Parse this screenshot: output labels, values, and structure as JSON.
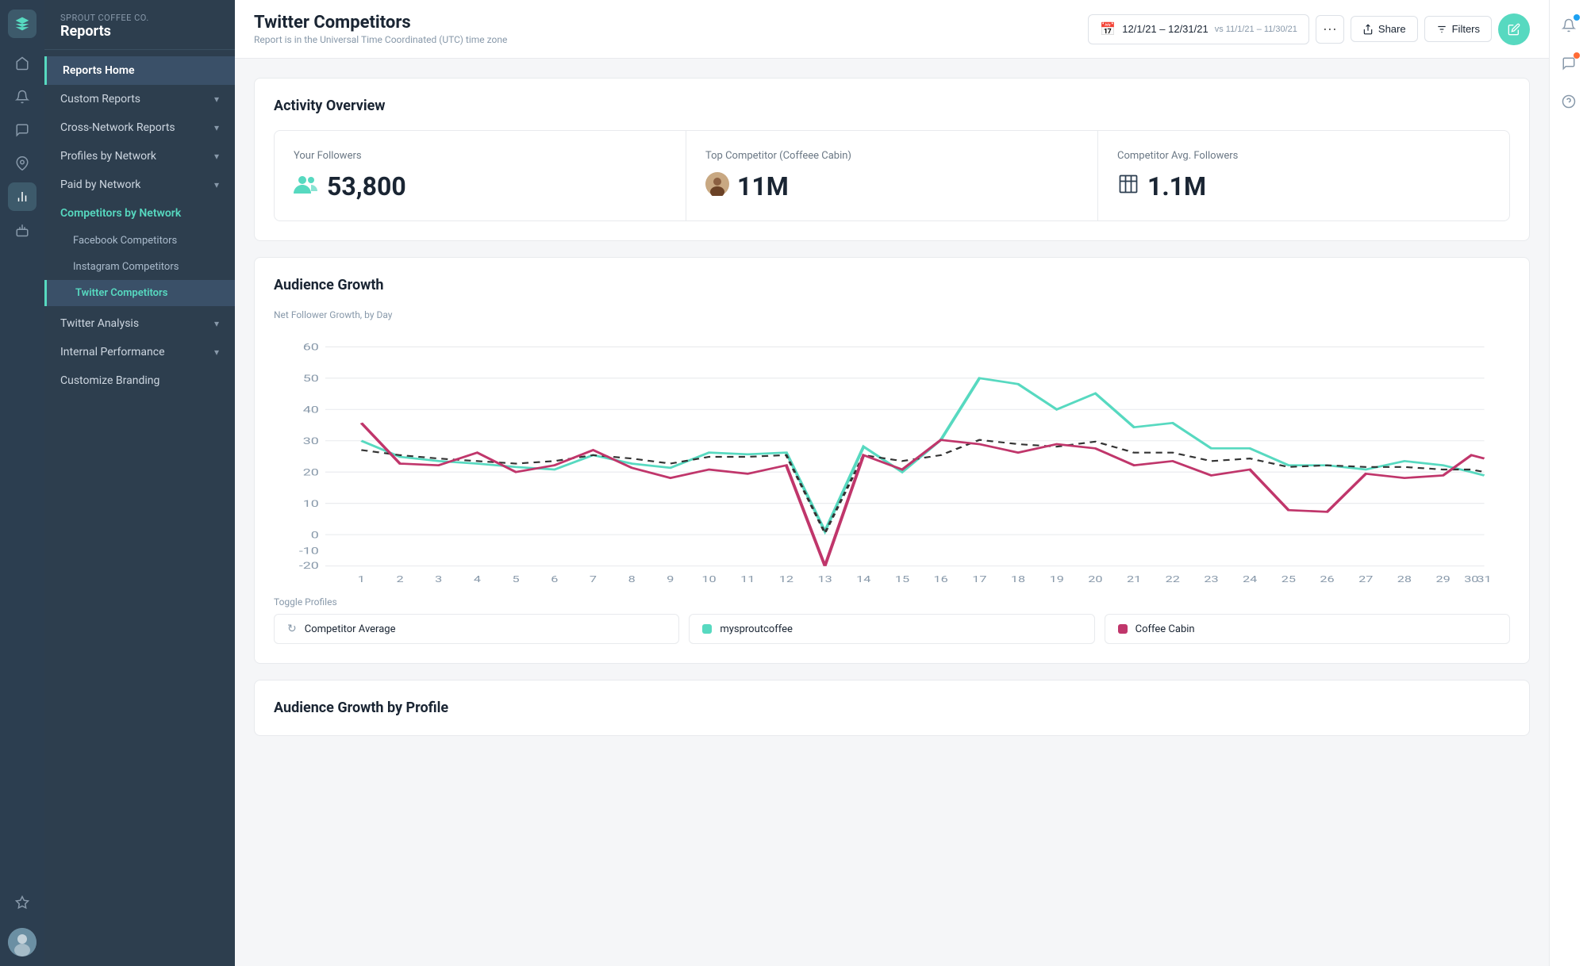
{
  "company": "Sprout Coffee Co.",
  "app_title": "Reports",
  "sidebar": {
    "items": [
      {
        "id": "reports-home",
        "label": "Reports Home",
        "active": true,
        "has_chevron": false
      },
      {
        "id": "custom-reports",
        "label": "Custom Reports",
        "active": false,
        "has_chevron": true
      },
      {
        "id": "cross-network",
        "label": "Cross-Network Reports",
        "active": false,
        "has_chevron": true
      },
      {
        "id": "profiles-by-network",
        "label": "Profiles by Network",
        "active": false,
        "has_chevron": true
      },
      {
        "id": "paid-by-network",
        "label": "Paid by Network",
        "active": false,
        "has_chevron": true
      },
      {
        "id": "competitors-by-network",
        "label": "Competitors by Network",
        "active": false,
        "highlighted": true,
        "has_chevron": false
      }
    ],
    "subitems": [
      {
        "id": "facebook-competitors",
        "label": "Facebook Competitors",
        "active": false
      },
      {
        "id": "instagram-competitors",
        "label": "Instagram Competitors",
        "active": false
      },
      {
        "id": "twitter-competitors",
        "label": "Twitter Competitors",
        "active": true
      }
    ],
    "bottom_items": [
      {
        "id": "twitter-analysis",
        "label": "Twitter Analysis",
        "has_chevron": true
      },
      {
        "id": "internal-performance",
        "label": "Internal Performance",
        "has_chevron": true
      },
      {
        "id": "customize-branding",
        "label": "Customize Branding",
        "has_chevron": false
      }
    ]
  },
  "rail_icons": [
    "☰",
    "💬",
    "📌",
    "📊",
    "🤖",
    "⭐"
  ],
  "header": {
    "title": "Twitter Competitors",
    "subtitle": "Report is in the Universal Time Coordinated (UTC) time zone",
    "date_range": "12/1/21 – 12/31/21",
    "vs_date": "vs 11/1/21 – 11/30/21",
    "share_label": "Share",
    "filters_label": "Filters"
  },
  "activity_overview": {
    "title": "Activity Overview",
    "your_followers_label": "Your Followers",
    "your_followers_value": "53,800",
    "top_competitor_label": "Top Competitor (Coffeee Cabin)",
    "top_competitor_value": "11M",
    "avg_followers_label": "Competitor Avg. Followers",
    "avg_followers_value": "1.1M"
  },
  "audience_growth": {
    "title": "Audience Growth",
    "chart_label": "Net Follower Growth, by Day",
    "toggle_label": "Toggle Profiles",
    "legend": [
      {
        "id": "competitor-avg",
        "label": "Competitor Average",
        "color": "#333",
        "type": "dotted"
      },
      {
        "id": "mysproutcoffee",
        "label": "mysproutcoffee",
        "color": "#57d9c0",
        "type": "solid"
      },
      {
        "id": "coffee-cabin",
        "label": "Coffee Cabin",
        "color": "#c0366b",
        "type": "solid"
      }
    ],
    "x_labels": [
      "1",
      "2",
      "3",
      "4",
      "5",
      "6",
      "7",
      "8",
      "9",
      "10",
      "11",
      "12",
      "13",
      "14",
      "15",
      "16",
      "17",
      "18",
      "19",
      "20",
      "21",
      "22",
      "23",
      "24",
      "25",
      "26",
      "27",
      "28",
      "29",
      "30",
      "31"
    ],
    "x_month": "Dec",
    "y_labels": [
      "-20",
      "-10",
      "0",
      "10",
      "20",
      "30",
      "40",
      "50",
      "60"
    ]
  },
  "audience_growth_by_profile": {
    "title": "Audience Growth by Profile"
  }
}
